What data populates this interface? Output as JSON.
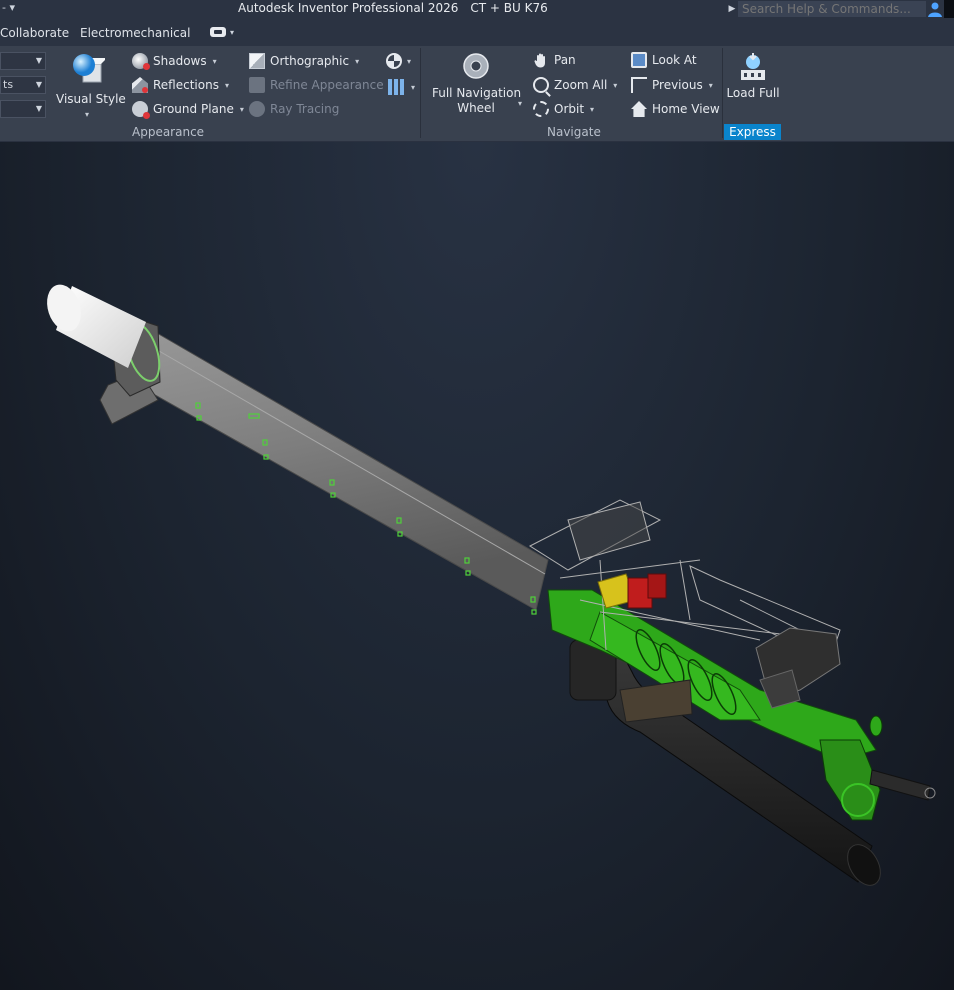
{
  "window": {
    "qat_symbol": "- ▾",
    "app_title": "Autodesk Inventor Professional 2026",
    "document_name": "CT + BU K76",
    "search_placeholder": "Search Help & Commands..."
  },
  "tabs": [
    {
      "label": "Collaborate"
    },
    {
      "label": "Electromechanical"
    }
  ],
  "ribbon": {
    "appearance": {
      "label": "Appearance",
      "dropdown_2_value": "ts",
      "visual_style": "Visual Style",
      "shadows": "Shadows",
      "reflections": "Reflections",
      "ground_plane": "Ground Plane",
      "orthographic": "Orthographic",
      "refine_appearance": "Refine Appearance",
      "ray_tracing": "Ray Tracing"
    },
    "navigate": {
      "label": "Navigate",
      "full_nav_wheel_line1": "Full Navigation",
      "full_nav_wheel_line2": "Wheel",
      "pan": "Pan",
      "zoom_all": "Zoom All",
      "orbit": "Orbit",
      "look_at": "Look At",
      "previous": "Previous",
      "home_view": "Home View"
    },
    "express": {
      "load_full": "Load Full",
      "label": "Express"
    }
  },
  "colors": {
    "accent": "#0a84cc",
    "model_green": "#2ea81a",
    "model_gray": "#8c8c8c",
    "model_yellow": "#d7c21c",
    "model_red": "#c01d1d"
  }
}
